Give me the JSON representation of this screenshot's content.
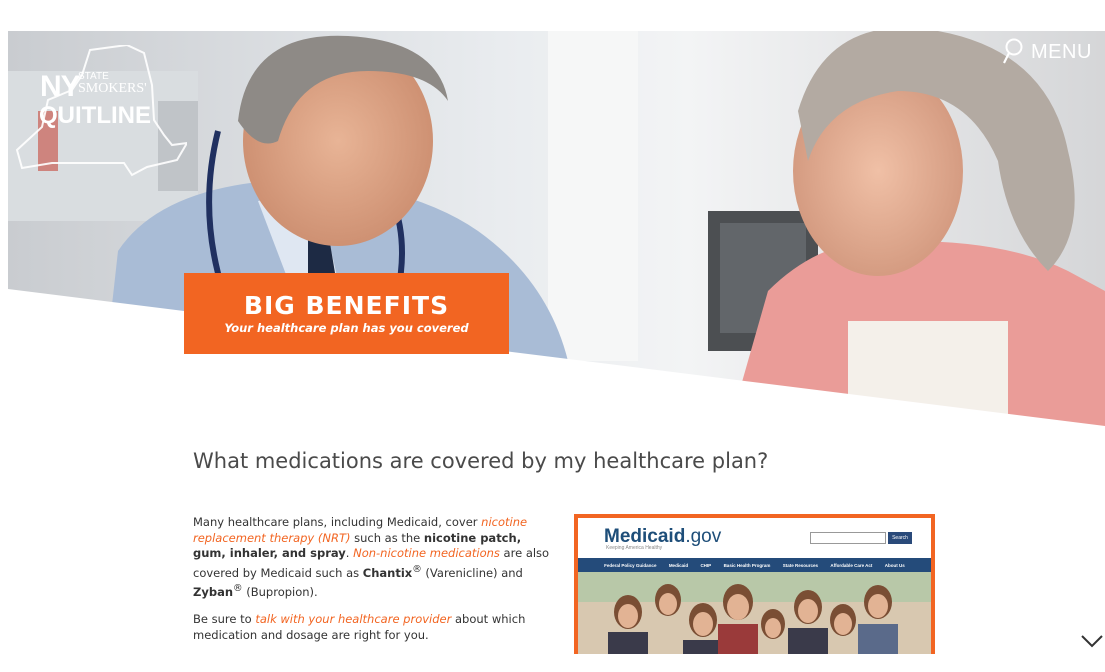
{
  "header": {
    "logo": {
      "line1": "NY",
      "state": "STATE",
      "smokers": "SMOKERS'",
      "line2": "QUITLINE"
    },
    "menu_label": "MENU",
    "menu_icon": "search-icon"
  },
  "hero": {
    "banner_title": "BIG BENEFITS",
    "banner_subtitle": "Your healthcare plan has you covered"
  },
  "content": {
    "question": "What medications are covered by my healthcare plan?",
    "p1": {
      "t1": "Many healthcare plans, including Medicaid, cover ",
      "link1": "nicotine replacement therapy (NRT)",
      "t2": " such as the ",
      "b1": "nicotine patch, gum, inhaler, and spray",
      "t3": ". ",
      "link2": "Non-nicotine medications",
      "t4": " are also covered by Medicaid such as ",
      "b2": "Chantix",
      "reg": "®",
      "t5": " (Varenicline) and ",
      "b3": "Zyban",
      "t6": " (Bupropion)."
    },
    "p2": {
      "t1": "Be sure to ",
      "link": "talk with your healthcare provider",
      "t2": " about which medication and dosage are right for you."
    }
  },
  "medicaid_image": {
    "logo_main": "Medicaid",
    "logo_domain": ".gov",
    "tagline": "Keeping America Healthy",
    "search_button": "Search",
    "nav": [
      "Federal Policy Guidance",
      "Medicaid",
      "CHIP",
      "Basic Health Program",
      "State Resources",
      "Affordable Care Act",
      "About Us"
    ]
  },
  "colors": {
    "accent": "#f26522",
    "text": "#333333",
    "heading": "#4a4a4a"
  },
  "scroll_icon": "chevron-down-icon"
}
